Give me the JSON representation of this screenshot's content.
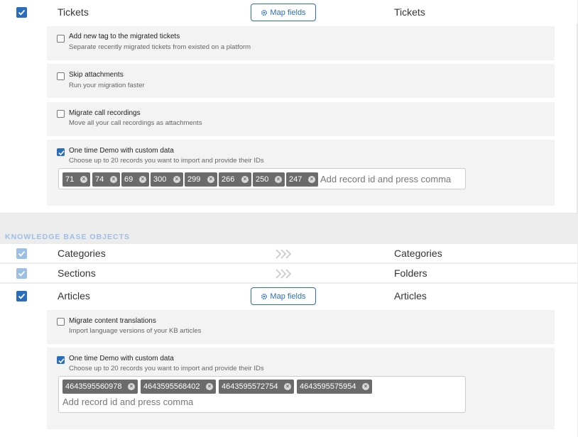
{
  "tickets": {
    "source": "Tickets",
    "destination": "Tickets",
    "map_fields_label": "Map fields",
    "options": [
      {
        "title": "Add new tag to the migrated tickets",
        "desc": "Separate recently migrated tickets from existed on a platform",
        "checked": false
      },
      {
        "title": "Skip attachments",
        "desc": "Run your migration faster",
        "checked": false
      },
      {
        "title": "Migrate call recordings",
        "desc": "Move all your call recordings as attachments",
        "checked": false
      },
      {
        "title": "One time Demo with custom data",
        "desc": "Choose up to 20 records you want to import and provide their IDs",
        "checked": true
      }
    ],
    "demo_ids": [
      "71",
      "74",
      "69",
      "300",
      "299",
      "266",
      "250",
      "247"
    ],
    "input_placeholder": "Add record id and press comma"
  },
  "kb": {
    "section_title": "KNOWLEDGE BASE OBJECTS",
    "rows": [
      {
        "source": "Categories",
        "destination": "Categories"
      },
      {
        "source": "Sections",
        "destination": "Folders"
      }
    ],
    "articles": {
      "source": "Articles",
      "destination": "Articles",
      "map_fields_label": "Map fields",
      "options": [
        {
          "title": "Migrate content translations",
          "desc": "Import language versions of your KB articles",
          "checked": false
        },
        {
          "title": "One time Demo with custom data",
          "desc": "Choose up to 20 records you want to import and provide their IDs",
          "checked": true
        }
      ],
      "demo_ids": [
        "4643595560978",
        "4643595568402",
        "4643595572754",
        "4643595575954"
      ],
      "input_placeholder": "Add record id and press comma"
    }
  },
  "colors": {
    "accent": "#2a6ebb",
    "accent_light": "#9dbfe6",
    "tag_bg": "#6b6b6b"
  }
}
